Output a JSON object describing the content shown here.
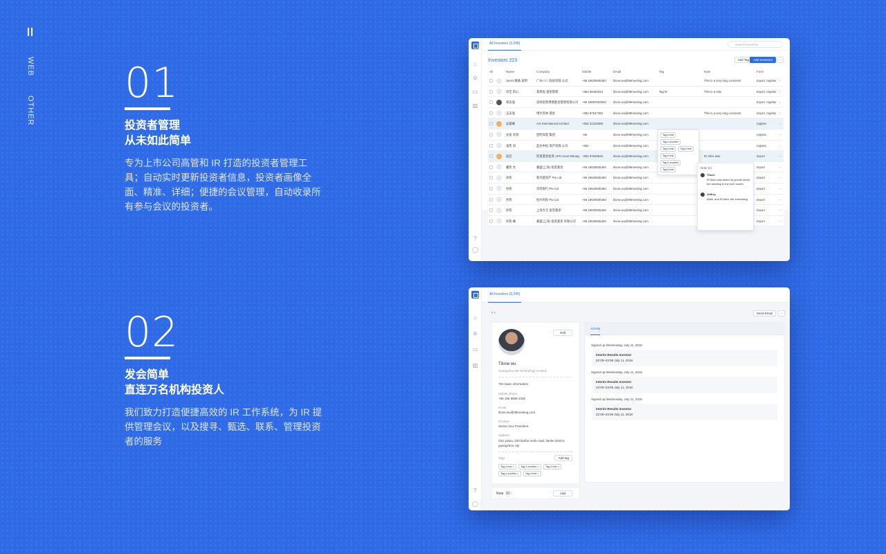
{
  "nav": {
    "items": [
      "WEB",
      "OTHER"
    ]
  },
  "section1": {
    "num": "01",
    "title1": "投资者管理",
    "title2": "从未如此简单",
    "desc": "专为上市公司高管和 IR 打造的投资者管理工具；自动实时更新投资者信息，投资者画像全面、精准、详细；便捷的会议管理，自动收录所有参与会议的投资者。"
  },
  "section2": {
    "num": "02",
    "title1": "发会简单",
    "title2": "直连万名机构投资人",
    "desc": "我们致力打造便捷高效的 IR 工作系统，为 IR 提供管理会议，以及搜寻、甄选、联系、管理投资者的服务"
  },
  "win1": {
    "tab": "All Investors (3,245)",
    "search_placeholder": "Search investors",
    "title": "Investors  223",
    "add_tag": "Add Tag",
    "add_investors": "Add Investors",
    "columns": [
      "All",
      "Name",
      "Company",
      "Mobile",
      "Email",
      "Tag",
      "Note",
      "Form"
    ],
    "rows": [
      {
        "name": "Jarvis 路路 说明",
        "company": "广州八八 科技有限 公司",
        "mobile": "+86 18629836483",
        "email": "tilone.wu@88meeting.com",
        "tag": "",
        "note": "This is a very long comment",
        "form": "import, register"
      },
      {
        "name": "肖艺 凯心",
        "company": "某某投 基金管理",
        "mobile": "+852 68469234",
        "email": "tilone.wu@88meeting.com",
        "tag": "Tag ttt",
        "note": "This is a note",
        "form": "import, register"
      },
      {
        "name": "郑志强",
        "company": "深圳金斯博德基金管理有限公司",
        "mobile": "+86 18887693603",
        "email": "tilone.wu@88meeting.com",
        "tag": "",
        "note": "",
        "form": "import, register"
      },
      {
        "name": "孟志强",
        "company": "博大资本 基金",
        "mobile": "+852 87547384",
        "email": "tilone.wu@88meeting.com",
        "tag": "",
        "note": "This is a very long comment",
        "form": "import, register"
      },
      {
        "name": "吴俊峰",
        "company": "AIA International Limited",
        "mobile": "+852 21233689",
        "email": "tilone.wu@88meeting.com",
        "tag": "",
        "note": "",
        "form": "register"
      },
      {
        "name": "长宽 天际",
        "company": "昆明深度 集团",
        "mobile": "+86",
        "email": "tilone.wu@88meeting.com",
        "tag": "",
        "note": "",
        "form": "register"
      },
      {
        "name": "张凯 同",
        "company": "亚太中投 资产有限 公司",
        "mobile": "+852",
        "email": "tilone.wu@88meeting.com",
        "tag": "",
        "note": "",
        "form": "register"
      },
      {
        "name": "赵启",
        "company": "阿里基金投资 APS Asset Management Asia",
        "mobile": "+852 87649632",
        "email": "tilone.wu@88meeting.com",
        "tag": "",
        "note": "IR Alice was",
        "form": "import"
      },
      {
        "name": "董凯 文",
        "company": "嘉盛(上海) 投资基金",
        "mobile": "+86 18629836483",
        "email": "tilone.wu@88meeting.com",
        "tag": "",
        "note": "",
        "form": "import"
      },
      {
        "name": "孙凯",
        "company": "新鸿基资产 Pte Ltd",
        "mobile": "+86 18629836483",
        "email": "tilone.wu@88meeting.com",
        "tag": "",
        "note": "",
        "form": "import"
      },
      {
        "name": "孙凯",
        "company": "华侨银行 Pte Ltd",
        "mobile": "+86 18629836483",
        "email": "tilone.wu@88meeting.com",
        "tag": "",
        "note": "",
        "form": "import"
      },
      {
        "name": "孙凯",
        "company": "恒大利民 Pte Ltd",
        "mobile": "+86 18629836483",
        "email": "tilone.wu@88meeting.com",
        "tag": "",
        "note": "",
        "form": "import"
      },
      {
        "name": "孙凯",
        "company": "上海大元 投资基金",
        "mobile": "+86 18629836483",
        "email": "tilone.wu@88meeting.com",
        "tag": "",
        "note": "",
        "form": "import"
      },
      {
        "name": "孙凯 峰",
        "company": "嘉盛(上海) 投资基金 有限公司",
        "mobile": "+86 18629836483",
        "email": "tilone.wu@88meeting.com",
        "tag": "",
        "note": "",
        "form": "import"
      }
    ],
    "tag_popup": [
      "Tag # test",
      "Tag # another",
      "Tag # test",
      "Tag # test",
      "Tag # test",
      "Tag # another",
      "Tag # test"
    ],
    "note_popup": {
      "title": "Note (2)",
      "items": [
        {
          "author": "Tilone",
          "text": "IR Alice was asked by phone about the meeting in the next month."
        },
        {
          "author": "Jeffrey",
          "text": "Aldia, and IR Alice are interesting"
        }
      ]
    }
  },
  "win2": {
    "tab": "All Investors (3,245)",
    "send_email": "Send Email",
    "edit": "Edit",
    "name": "Tilone wu",
    "company": "Guangzhou 88 Technology Limited",
    "basic_info": "The basic information",
    "fields": [
      {
        "label": "Mobile phone",
        "value": "+86 186 8668 2345"
      },
      {
        "label": "Email",
        "value": "tilone.wu@88meeting.com"
      },
      {
        "label": "Position",
        "value": "Senior Vice President"
      },
      {
        "label": "Address",
        "value": "Citic plaza, 233 tianhe north road, tianhe district, guangzhou city"
      }
    ],
    "tags_label": "Tags",
    "add_tag": "Add tag",
    "tags": [
      "Tag # test",
      "Tag # another",
      "Tag # test",
      "Tag # another",
      "Tag # test"
    ],
    "note_label": "Note（0）：",
    "add": "Add",
    "activity_tab": "Activity",
    "activities": [
      {
        "date": "Signed up Wednesday, July 11, 2018",
        "event": "Interim Results Investor",
        "time": "22:00~23:59 July 11, 2018"
      },
      {
        "date": "Signed up Wednesday, July 11, 2018",
        "event": "Interim Results Investor",
        "time": "22:00~23:59 July 11, 2018"
      },
      {
        "date": "Signed up Wednesday, July 11, 2018",
        "event": "Interim Results Investor",
        "time": "22:00~23:59 July 11, 2018"
      }
    ]
  }
}
